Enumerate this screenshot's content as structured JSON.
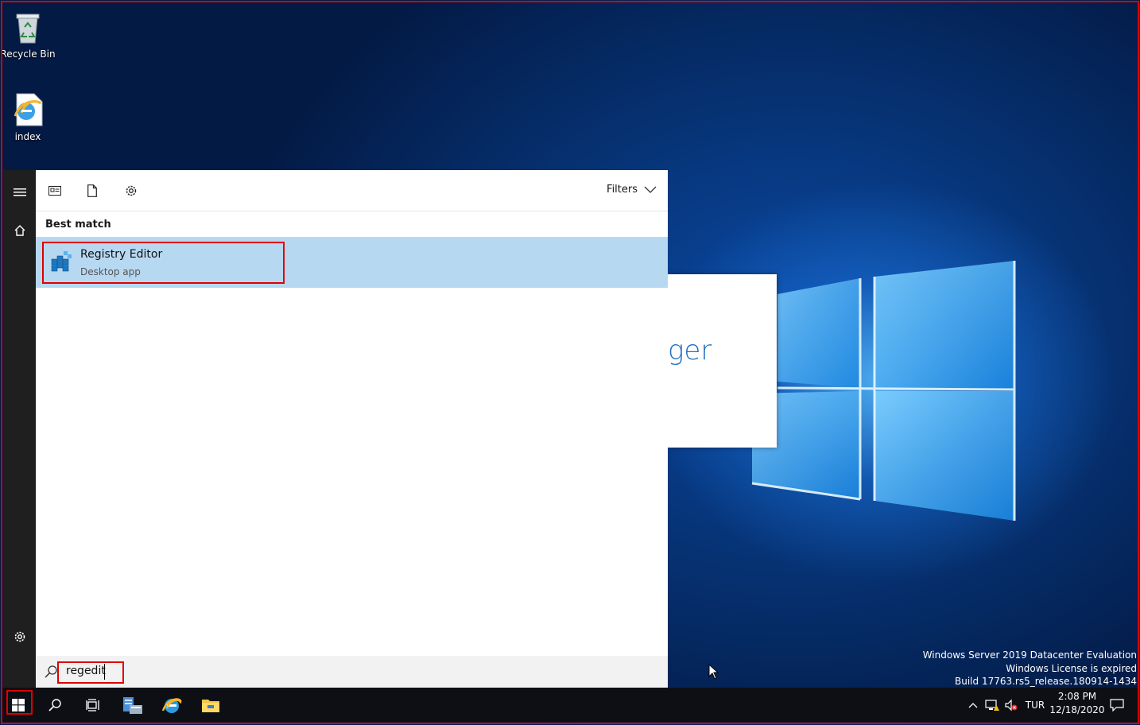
{
  "desktop": {
    "icons": [
      {
        "label": "Recycle Bin",
        "icon": "recycle-bin-icon"
      },
      {
        "label": "index",
        "icon": "internet-explorer-file-icon"
      }
    ],
    "background_dialog_fragment": "ger"
  },
  "start_menu": {
    "rail": {
      "menu_icon": "hamburger-icon",
      "home_icon": "home-icon",
      "settings_icon": "gear-icon"
    },
    "header": {
      "tabs": [
        "apps-icon",
        "documents-icon",
        "settings-icon"
      ],
      "filters_label": "Filters"
    },
    "best_match_label": "Best match",
    "result": {
      "title": "Registry Editor",
      "subtitle": "Desktop app",
      "icon": "registry-editor-icon"
    },
    "search": {
      "value": "regedit",
      "icon": "search-icon"
    }
  },
  "taskbar": {
    "apps": [
      "windows-start-icon",
      "search-icon",
      "task-view-icon",
      "server-manager-icon",
      "internet-explorer-icon",
      "file-explorer-icon"
    ],
    "tray": {
      "language": "TUR",
      "time": "2:08 PM",
      "date": "12/18/2020"
    }
  },
  "watermark": {
    "line1": "Windows Server 2019 Datacenter Evaluation",
    "line2": "Windows License is expired",
    "line3": "Build 17763.rs5_release.180914-1434"
  },
  "colors": {
    "highlight_border": "#e00000",
    "result_selected": "#b7d8f1",
    "taskbar": "#0d0f14",
    "rail": "#1f1f1f"
  }
}
